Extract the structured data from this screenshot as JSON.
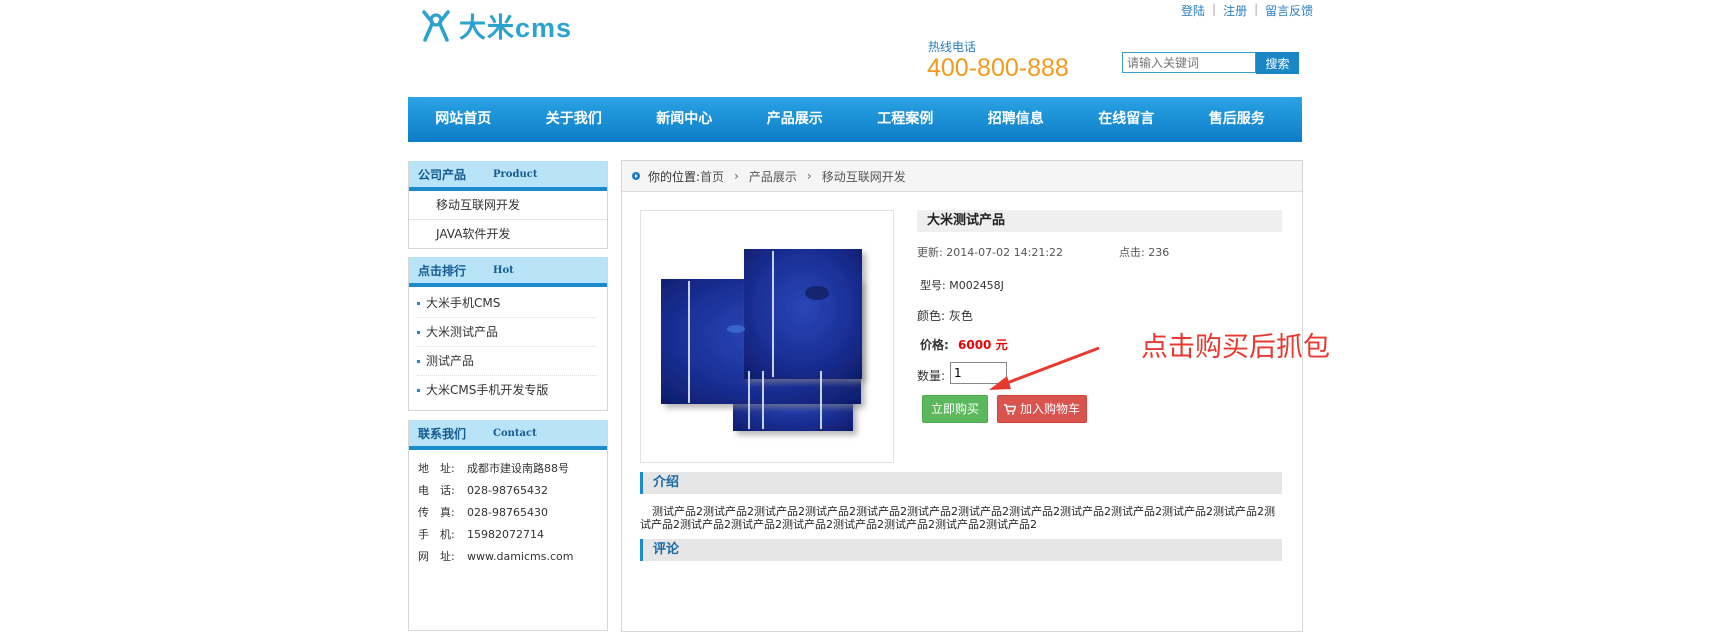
{
  "header": {
    "logo_text": "大米cms",
    "top_links": [
      "登陆",
      "注册",
      "留言反馈"
    ],
    "hotline_label": "热线电话",
    "hotline_number": "400-800-888",
    "search_placeholder": "请输入关键词",
    "search_button": "搜索"
  },
  "nav": [
    "网站首页",
    "关于我们",
    "新闻中心",
    "产品展示",
    "工程案例",
    "招聘信息",
    "在线留言",
    "售后服务"
  ],
  "sidebar": {
    "products": {
      "title_cn": "公司产品",
      "title_en": "Product",
      "items": [
        "移动互联网开发",
        "JAVA软件开发"
      ]
    },
    "hot": {
      "title_cn": "点击排行",
      "title_en": "Hot",
      "items": [
        "大米手机CMS",
        "大米测试产品",
        "测试产品",
        "大米CMS手机开发专版"
      ]
    },
    "contact": {
      "title_cn": "联系我们",
      "title_en": "Contact",
      "rows": [
        {
          "k": "地　址:",
          "v": "成都市建设南路88号"
        },
        {
          "k": "电　话:",
          "v": "028-98765432"
        },
        {
          "k": "传　真:",
          "v": "028-98765430"
        },
        {
          "k": "手　机:",
          "v": "15982072714"
        },
        {
          "k": "网　址:",
          "v": "www.damicms.com"
        }
      ]
    }
  },
  "breadcrumb": {
    "label": "你的位置:",
    "items": [
      "首页",
      "产品展示",
      "移动互联网开发"
    ]
  },
  "product": {
    "title": "大米测试产品",
    "updated": "更新: 2014-07-02 14:21:22",
    "clicks": "点击: 236",
    "model": "型号: M002458J",
    "color": "颜色: 灰色",
    "price_label": "价格:",
    "price": "6000 元",
    "qty_label": "数量:",
    "qty_value": "1",
    "buy_button": "立即购买",
    "cart_button": "加入购物车"
  },
  "sections": {
    "intro_title": "介绍",
    "intro_text": "测试产品2测试产品2测试产品2测试产品2测试产品2测试产品2测试产品2测试产品2测试产品2测试产品2测试产品2测试产品2测试产品2测试产品2测试产品2测试产品2测试产品2测试产品2测试产品2测试产品2",
    "comment_title": "评论"
  },
  "annotation": "点击购买后抓包",
  "colors": {
    "accent": "#1a8ccd",
    "price": "#ee0000",
    "hotline": "#f39a1c",
    "annotation": "#e8392f"
  }
}
